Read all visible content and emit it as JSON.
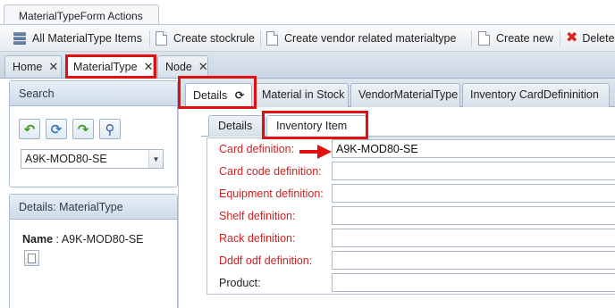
{
  "ribbon": {
    "tab_label": "MaterialTypeForm Actions"
  },
  "toolbar": {
    "items": [
      {
        "label": "All MaterialType Items",
        "icon": "list-icon"
      },
      {
        "label": "Create stockrule",
        "icon": "document-icon"
      },
      {
        "label": "Create vendor related materialtype",
        "icon": "document-icon"
      },
      {
        "label": "Create new",
        "icon": "document-icon"
      },
      {
        "label": "Delete",
        "icon": "delete-icon"
      }
    ]
  },
  "page_tabs": [
    {
      "label": "Home",
      "close": "✕"
    },
    {
      "label": "MaterialType",
      "close": "✕"
    },
    {
      "label": "Node",
      "close": "✕"
    }
  ],
  "search": {
    "title": "Search",
    "selected_value": "A9K-MOD80-SE",
    "buttons": [
      "back-icon",
      "refresh-icon",
      "forward-icon",
      "binoculars-icon"
    ]
  },
  "details_box": {
    "title": "Details: MaterialType",
    "name_label": "Name",
    "name_sep": ":",
    "name_value": "A9K-MOD80-SE"
  },
  "inner_tabs": [
    {
      "label": "Details"
    },
    {
      "label": "Material in Stock"
    },
    {
      "label": "VendorMaterialType"
    },
    {
      "label": "Inventory CardDefininition"
    }
  ],
  "sub_tabs": [
    {
      "label": "Details"
    },
    {
      "label": "Inventory Item"
    }
  ],
  "form": {
    "fields": [
      {
        "label": "Card definition:",
        "value": "A9K-MOD80-SE",
        "required": true
      },
      {
        "label": "Card code definition:",
        "value": "",
        "required": true
      },
      {
        "label": "Equipment definition:",
        "value": "",
        "required": true
      },
      {
        "label": "Shelf definition:",
        "value": "",
        "required": true
      },
      {
        "label": "Rack definition:",
        "value": "",
        "required": true
      },
      {
        "label": "Dddf odf definition:",
        "value": "",
        "required": true
      },
      {
        "label": "Product:",
        "value": "",
        "required": false
      }
    ]
  },
  "colors": {
    "highlight": "#e01010",
    "required_label": "#cc2222",
    "accent": "#c9d5e2"
  }
}
